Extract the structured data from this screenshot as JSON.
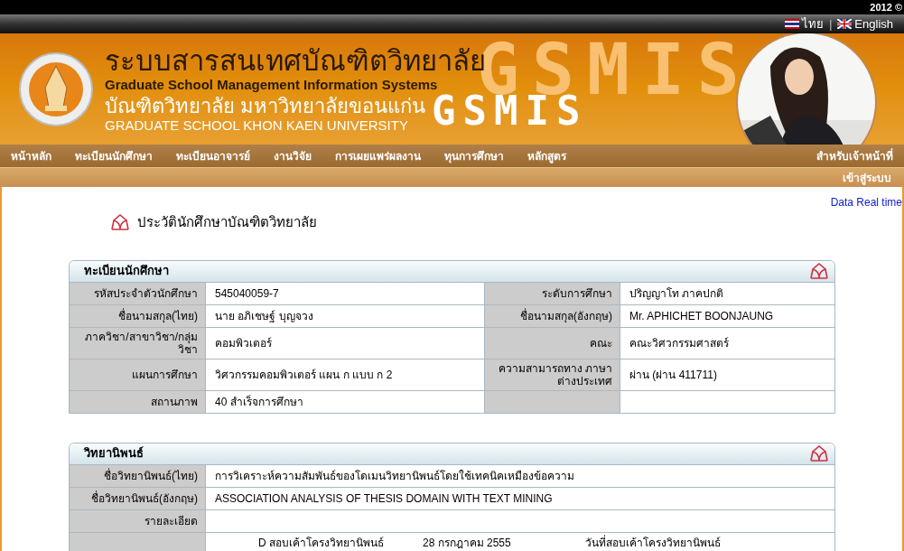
{
  "top_bar": {
    "copyright": "2012 ©"
  },
  "language_separator": "|",
  "languages": [
    {
      "label": "ไทย",
      "kind": "th"
    },
    {
      "label": "English",
      "kind": "en"
    }
  ],
  "banner": {
    "title_th": "ระบบสารสนเทศบัณฑิตวิทยาลัย",
    "title_en": "Graduate School Management Information Systems",
    "university_th": "บัณฑิตวิทยาลัย มหาวิทยาลัยขอนแก่น",
    "university_en": "GRADUATE SCHOOL KHON KAEN UNIVERSITY",
    "backdrop_text": "GSMIS",
    "logo_text": "GSMIS"
  },
  "nav": {
    "items": [
      "หน้าหลัก",
      "ทะเบียนนักศึกษา",
      "ทะเบียนอาจารย์",
      "งานวิจัย",
      "การเผยแพร่ผลงาน",
      "ทุนการศึกษา",
      "หลักสูตร"
    ],
    "right": "สำหรับเจ้าหน้าที่",
    "login": "เข้าสู่ระบบ"
  },
  "data_link": "Data Real time",
  "page_title": "ประวัตินักศึกษาบัณฑิตวิทยาลัย",
  "panels": [
    {
      "title": "ทะเบียนนักศึกษา",
      "rows": [
        {
          "kind": "pair",
          "cells": [
            {
              "label": "รหัสประจำตัวนักศึกษา",
              "value": "545040059-7"
            },
            {
              "label": "ระดับการศึกษา",
              "value": "ปริญญาโท ภาคปกติ"
            }
          ]
        },
        {
          "kind": "pair",
          "cells": [
            {
              "label": "ชื่อนามสกุล(ไทย)",
              "value": "นาย อภิเชษฐ์ บุญจวง"
            },
            {
              "label": "ชื่อนามสกุล(อังกฤษ)",
              "value": "Mr. APHICHET BOONJAUNG"
            }
          ]
        },
        {
          "kind": "pair",
          "cells": [
            {
              "label": "ภาควิชา/สาขาวิชา/กลุ่มวิชา",
              "value": "คอมพิวเตอร์"
            },
            {
              "label": "คณะ",
              "value": "คณะวิศวกรรมศาสตร์"
            }
          ]
        },
        {
          "kind": "pair",
          "cells": [
            {
              "label": "แผนการศึกษา",
              "value": "วิศวกรรมคอมพิวเตอร์ แผน ก แบบ ก 2"
            },
            {
              "label": "ความสามารถทาง ภาษาต่างประเทศ",
              "value": "ผ่าน (ผ่าน 411711)"
            }
          ]
        },
        {
          "kind": "pair",
          "cells": [
            {
              "label": "สถานภาพ",
              "value": "40  สำเร็จการศึกษา"
            },
            {}
          ]
        }
      ]
    },
    {
      "title": "วิทยานิพนธ์",
      "rows": [
        {
          "kind": "wide",
          "cells": [
            {
              "label": "ชื่อวิทยานิพนธ์(ไทย)",
              "value": "การวิเคราะห์ความสัมพันธ์ของโดเมนวิทยานิพนธ์โดยใช้เทคนิคเหมืองข้อความ"
            }
          ]
        },
        {
          "kind": "wide",
          "cells": [
            {
              "label": "ชื่อวิทยานิพนธ์(อังกฤษ)",
              "value": "ASSOCIATION ANALYSIS OF THESIS DOMAIN WITH TEXT MINING"
            }
          ]
        },
        {
          "kind": "wide",
          "cells": [
            {
              "label": "รายละเอียด"
            }
          ]
        },
        {
          "kind": "multi",
          "values": [
            "D สอบเค้าโครงวิทยานิพนธ์",
            "28 กรกฎาคม 2555",
            "วันที่สอบเค้าโครงวิทยานิพนธ์"
          ]
        }
      ]
    }
  ]
}
